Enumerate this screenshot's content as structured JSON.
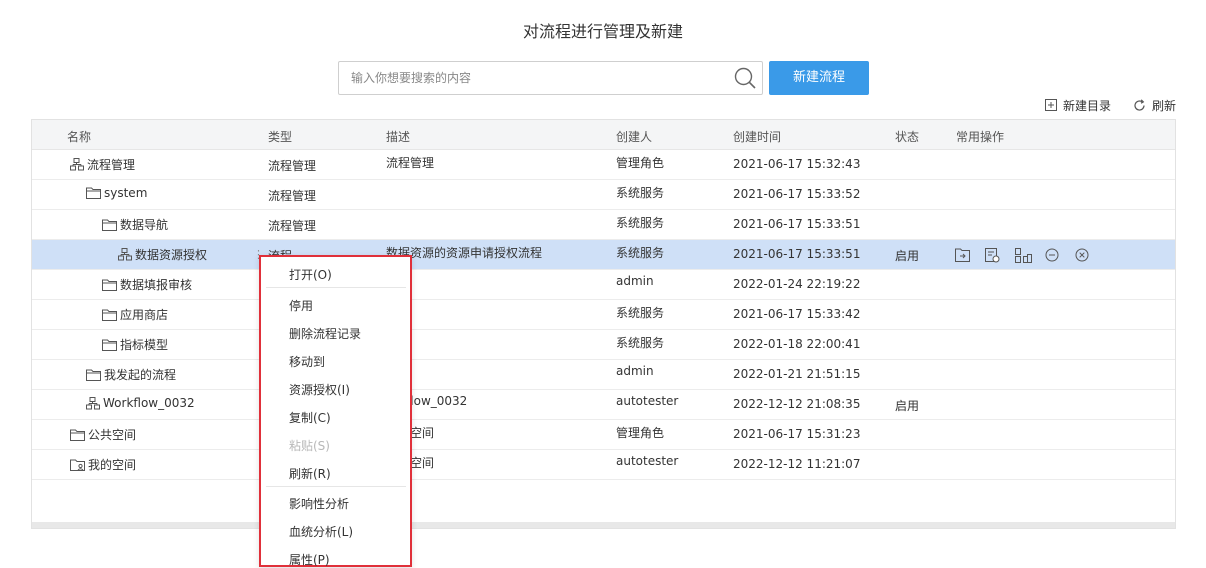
{
  "page_title": "对流程进行管理及新建",
  "search": {
    "placeholder": "输入你想要搜索的内容",
    "value": ""
  },
  "new_flow_button": "新建流程",
  "toolbar": {
    "new_dir": "新建目录",
    "refresh": "刷新"
  },
  "columns": [
    "名称",
    "类型",
    "描述",
    "创建人",
    "创建时间",
    "状态",
    "常用操作"
  ],
  "rows": [
    {
      "name": "流程管理",
      "icon": "flow-icon",
      "type": "流程管理",
      "desc": "流程管理",
      "creator": "管理角色",
      "time": "2021-06-17 15:32:43",
      "status": ""
    },
    {
      "name": "system",
      "icon": "folder-icon",
      "type": "流程管理",
      "desc": "",
      "creator": "系统服务",
      "time": "2021-06-17 15:33:52",
      "status": ""
    },
    {
      "name": "数据导航",
      "icon": "folder-icon",
      "type": "流程管理",
      "desc": "",
      "creator": "系统服务",
      "time": "2021-06-17 15:33:51",
      "status": ""
    },
    {
      "name": "数据资源授权",
      "icon": "flow-icon",
      "type": "流程",
      "desc": "数据资源的资源申请授权流程",
      "creator": "系统服务",
      "time": "2021-06-17 15:33:51",
      "status": "启用"
    },
    {
      "name": "数据填报审核",
      "icon": "folder-icon",
      "type": "",
      "desc": "",
      "creator": "admin",
      "time": "2022-01-24 22:19:22",
      "status": ""
    },
    {
      "name": "应用商店",
      "icon": "folder-icon",
      "type": "",
      "desc": "",
      "creator": "系统服务",
      "time": "2021-06-17 15:33:42",
      "status": ""
    },
    {
      "name": "指标模型",
      "icon": "folder-icon",
      "type": "",
      "desc": "",
      "creator": "系统服务",
      "time": "2022-01-18 22:00:41",
      "status": ""
    },
    {
      "name": "我发起的流程",
      "icon": "folder-icon",
      "type": "",
      "desc": "",
      "creator": "admin",
      "time": "2022-01-21 21:51:15",
      "status": ""
    },
    {
      "name": "Workflow_0032",
      "icon": "flow-icon",
      "type": "",
      "desc": ":flow_0032",
      "creator": "autotester",
      "time": "2022-12-12 21:08:35",
      "status": "启用"
    },
    {
      "name": "公共空间",
      "icon": "folder-icon",
      "type": "",
      "desc": "空间",
      "creator": "管理角色",
      "time": "2021-06-17 15:31:23",
      "status": ""
    },
    {
      "name": "我的空间",
      "icon": "personal-folder-icon",
      "type": "",
      "desc": "空间",
      "creator": "autotester",
      "time": "2022-12-12 11:21:07",
      "status": ""
    }
  ],
  "context_menu": [
    {
      "label": "打开(O)",
      "disabled": false
    },
    {
      "label": "停用",
      "disabled": false
    },
    {
      "label": "删除流程记录",
      "disabled": false
    },
    {
      "label": "移动到",
      "disabled": false
    },
    {
      "label": "资源授权(I)",
      "disabled": false
    },
    {
      "label": "复制(C)",
      "disabled": false
    },
    {
      "label": "粘贴(S)",
      "disabled": true
    },
    {
      "label": "刷新(R)",
      "disabled": false
    },
    {
      "label": "影响性分析",
      "disabled": false
    },
    {
      "label": "血统分析(L)",
      "disabled": false
    },
    {
      "label": "属性(P)",
      "disabled": false
    }
  ],
  "row_actions": [
    "export-icon",
    "edit-settings-icon",
    "flow-design-icon",
    "disable-icon",
    "delete-icon"
  ],
  "colors": {
    "accent": "#3a9ae8",
    "selected_row": "#cfe0f7",
    "highlight_border": "#e0303a"
  }
}
